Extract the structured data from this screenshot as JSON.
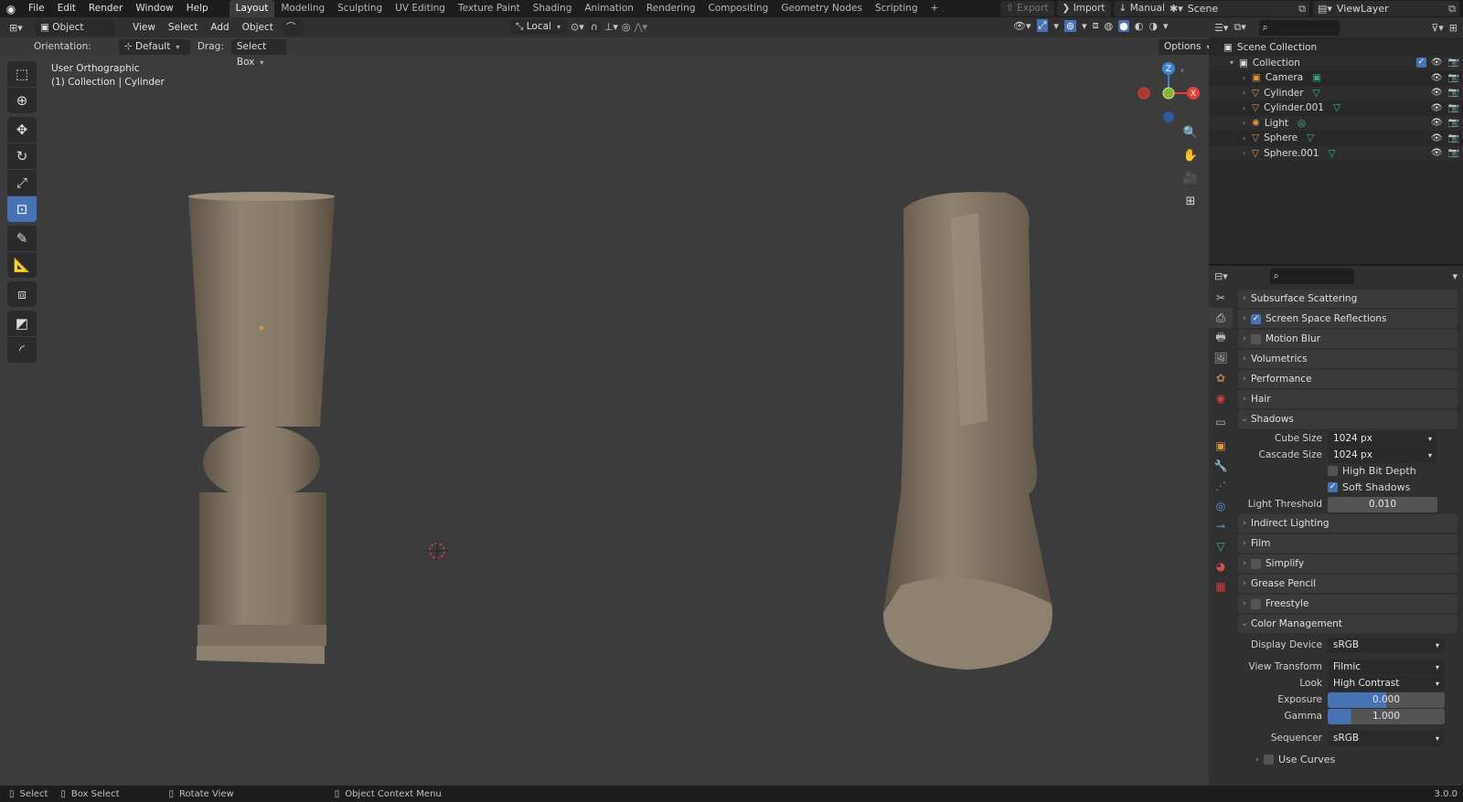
{
  "topbar": {
    "menus": [
      "File",
      "Edit",
      "Render",
      "Window",
      "Help"
    ],
    "workspaces": [
      "Layout",
      "Modeling",
      "Sculpting",
      "UV Editing",
      "Texture Paint",
      "Shading",
      "Animation",
      "Rendering",
      "Compositing",
      "Geometry Nodes",
      "Scripting"
    ],
    "active_workspace": "Layout",
    "add_tab": "+",
    "export_label": "Export",
    "import_label": "Import",
    "manual_label": "Manual",
    "scene_name": "Scene",
    "view_layer": "ViewLayer"
  },
  "viewport": {
    "mode": "Object Mode",
    "menus": [
      "View",
      "Select",
      "Add",
      "Object"
    ],
    "transform_space": "Local",
    "orientation_label": "Orientation:",
    "orientation_value": "Default",
    "drag_label": "Drag:",
    "drag_value": "Select Box",
    "options_label": "Options",
    "view_name": "User Orthographic",
    "collection_info": "(1) Collection | Cylinder",
    "gizmo": {
      "x": "X",
      "y": "Y",
      "z": "Z"
    }
  },
  "outliner": {
    "root": "Scene Collection",
    "collection": "Collection",
    "items": [
      {
        "name": "Camera",
        "icon": "camera-icon",
        "color": "#e0953d",
        "data_icon": "camera-data-icon",
        "data_color": "#3aa57d"
      },
      {
        "name": "Cylinder",
        "icon": "mesh-object-icon",
        "color": "#e0953d",
        "data_icon": "mesh-data-icon",
        "data_color": "#40c080"
      },
      {
        "name": "Cylinder.001",
        "icon": "mesh-object-icon",
        "color": "#e0953d",
        "data_icon": "mesh-data-icon",
        "data_color": "#40c080"
      },
      {
        "name": "Light",
        "icon": "light-icon",
        "color": "#e0953d",
        "data_icon": "light-data-icon",
        "data_color": "#40c080"
      },
      {
        "name": "Sphere",
        "icon": "mesh-object-icon",
        "color": "#e0953d",
        "data_icon": "mesh-data-icon",
        "data_color": "#40c080"
      },
      {
        "name": "Sphere.001",
        "icon": "mesh-object-icon",
        "color": "#e0953d",
        "data_icon": "mesh-data-icon",
        "data_color": "#40c080"
      }
    ]
  },
  "properties": {
    "panels_top": [
      {
        "label": "Subsurface Scattering",
        "checkbox": null
      },
      {
        "label": "Screen Space Reflections",
        "checkbox": true
      },
      {
        "label": "Motion Blur",
        "checkbox": false
      },
      {
        "label": "Volumetrics",
        "checkbox": null
      },
      {
        "label": "Performance",
        "checkbox": null
      },
      {
        "label": "Hair",
        "checkbox": null
      }
    ],
    "shadows": {
      "label": "Shadows",
      "cube_size_label": "Cube Size",
      "cube_size": "1024 px",
      "cascade_size_label": "Cascade Size",
      "cascade_size": "1024 px",
      "high_bit_depth": "High Bit Depth",
      "soft_shadows": "Soft Shadows",
      "light_threshold_label": "Light Threshold",
      "light_threshold": "0.010"
    },
    "panels_mid": [
      {
        "label": "Indirect Lighting",
        "checkbox": null
      },
      {
        "label": "Film",
        "checkbox": null
      },
      {
        "label": "Simplify",
        "checkbox": false
      },
      {
        "label": "Grease Pencil",
        "checkbox": null
      },
      {
        "label": "Freestyle",
        "checkbox": false
      }
    ],
    "color_management": {
      "label": "Color Management",
      "display_device_label": "Display Device",
      "display_device": "sRGB",
      "view_transform_label": "View Transform",
      "view_transform": "Filmic",
      "look_label": "Look",
      "look": "High Contrast",
      "exposure_label": "Exposure",
      "exposure": "0.000",
      "gamma_label": "Gamma",
      "gamma": "1.000",
      "sequencer_label": "Sequencer",
      "sequencer": "sRGB",
      "use_curves": "Use Curves"
    }
  },
  "statusbar": {
    "select": "Select",
    "box_select": "Box Select",
    "rotate_view": "Rotate View",
    "context_menu": "Object Context Menu",
    "version": "3.0.0"
  },
  "colors": {
    "accent": "#4772b3",
    "axis_x": "#e0403c",
    "axis_y": "#8bb33a",
    "axis_z": "#3b83d6",
    "object_orange": "#e0953d",
    "mesh_color": "#8a7c6b"
  }
}
